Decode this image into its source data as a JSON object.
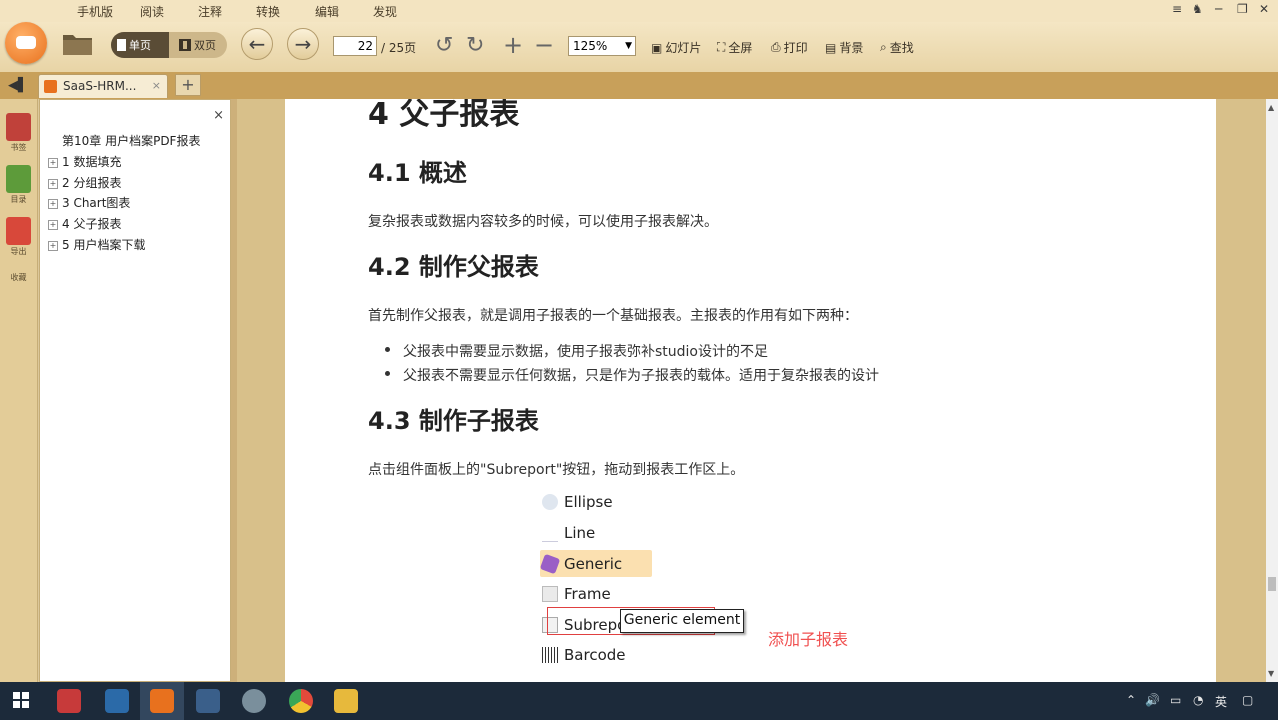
{
  "menu": [
    "手机版",
    "阅读",
    "注释",
    "转换",
    "编辑",
    "发现"
  ],
  "window_controls": [
    "≡",
    "♞",
    "─",
    "❐",
    "✕"
  ],
  "toolbar": {
    "single_page": "单页",
    "double_page": "双页",
    "current_page": "22",
    "total_pages": "/ 25页",
    "zoom": "125%",
    "slideshow": "幻灯片",
    "fullscreen": "全屏",
    "print": "打印",
    "background": "背景",
    "find": "查找"
  },
  "tab": {
    "title": "SaaS-HRM...",
    "close": "×",
    "new": "+"
  },
  "leftstrip": {
    "labels": [
      "书签",
      "目录",
      "导出",
      "收藏"
    ]
  },
  "outline": {
    "close": "×",
    "items": [
      {
        "label": "第10章 用户档案PDF报表",
        "expandable": false
      },
      {
        "label": "1 数据填充",
        "expandable": true
      },
      {
        "label": "2 分组报表",
        "expandable": true
      },
      {
        "label": "3 Chart图表",
        "expandable": true
      },
      {
        "label": "4 父子报表",
        "expandable": true
      },
      {
        "label": "5 用户档案下载",
        "expandable": true
      }
    ]
  },
  "document": {
    "h1": "4 父子报表",
    "s41_title": "4.1 概述",
    "s41_text": "复杂报表或数据内容较多的时候，可以使用子报表解决。",
    "s42_title": "4.2 制作父报表",
    "s42_text": "首先制作父报表，就是调用子报表的一个基础报表。主报表的作用有如下两种：",
    "s42_bullets": [
      "父报表中需要显示数据，使用子报表弥补studio设计的不足",
      "父报表不需要显示任何数据，只是作为子报表的载体。适用于复杂报表的设计"
    ],
    "s43_title": "4.3 制作子报表",
    "s43_text": "点击组件面板上的\"Subreport\"按钮，拖动到报表工作区上。",
    "palette": [
      "Ellipse",
      "Line",
      "Generic",
      "Frame",
      "Subrepo",
      "Barcode"
    ],
    "tooltip": "Generic element",
    "annotation": "添加子报表"
  },
  "taskbar": {
    "ime": "英"
  }
}
